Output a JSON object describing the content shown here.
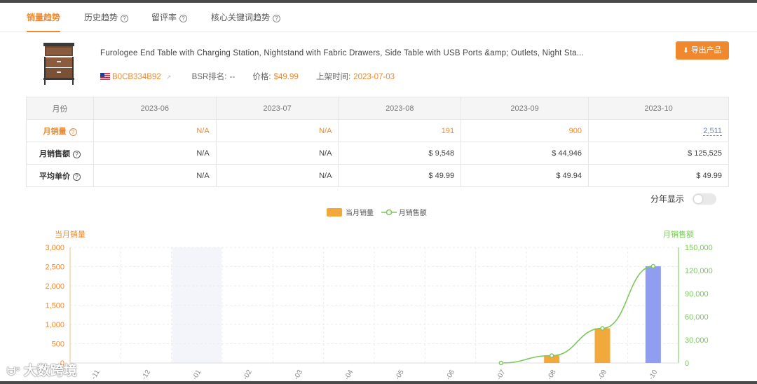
{
  "tabs": [
    {
      "label": "销量趋势",
      "active": true
    },
    {
      "label": "历史趋势",
      "active": false
    },
    {
      "label": "留评率",
      "active": false
    },
    {
      "label": "核心关键词趋势",
      "active": false
    }
  ],
  "product": {
    "title": "Furologee End Table with Charging Station, Nightstand with Fabric Drawers, Side Table with USB Ports &amp; Outlets, Night Sta...",
    "asin": "B0CB334B92",
    "bsr_label": "BSR排名:",
    "bsr_value": "--",
    "price_label": "价格:",
    "price_value": "$49.99",
    "date_label": "上架时间:",
    "date_value": "2023-07-03",
    "export_label": "导出产品"
  },
  "table": {
    "header_label": "月份",
    "months": [
      "2023-06",
      "2023-07",
      "2023-08",
      "2023-09",
      "2023-10"
    ],
    "rows": [
      {
        "label": "月销量",
        "values": [
          "N/A",
          "N/A",
          "191",
          "900",
          "2,511"
        ]
      },
      {
        "label": "月销售额",
        "values": [
          "N/A",
          "N/A",
          "$ 9,548",
          "$ 44,946",
          "$ 125,525"
        ]
      },
      {
        "label": "平均单价",
        "values": [
          "N/A",
          "N/A",
          "$ 49.99",
          "$ 49.94",
          "$ 49.99"
        ]
      }
    ]
  },
  "toggle": {
    "label": "分年显示",
    "on": false
  },
  "legend": {
    "bar_label": "当月销量",
    "line_label": "月销售额"
  },
  "watermark": "大数跨境",
  "colors": {
    "accent": "#f0892e",
    "bar": "#f2a93b",
    "bar_highlight": "#8f9ef0",
    "line": "#7ac95b"
  },
  "chart_data": {
    "type": "bar",
    "left_axis_label": "当月销量",
    "right_axis_label": "月销售额",
    "categories": [
      "-11",
      "-12",
      "-01",
      "-02",
      "-03",
      "-04",
      "-05",
      "-06",
      "-07",
      "-08",
      "-09",
      "-10"
    ],
    "series": [
      {
        "name": "当月销量",
        "type": "bar",
        "axis": "left",
        "values": [
          null,
          null,
          null,
          null,
          null,
          null,
          null,
          null,
          null,
          191,
          900,
          2511
        ]
      },
      {
        "name": "月销售额",
        "type": "line",
        "axis": "right",
        "values": [
          null,
          null,
          null,
          null,
          null,
          null,
          null,
          null,
          0,
          9548,
          44946,
          125525
        ]
      }
    ],
    "left_ticks": [
      "0",
      "500",
      "1,000",
      "1,500",
      "2,000",
      "2,500",
      "3,000"
    ],
    "right_ticks": [
      "0",
      "30,000",
      "60,000",
      "90,000",
      "120,000",
      "150,000"
    ],
    "ylim_left": [
      0,
      3000
    ],
    "ylim_right": [
      0,
      150000
    ],
    "highlighted_bar_index": 11,
    "shaded_category_index": 2,
    "grid": true
  }
}
